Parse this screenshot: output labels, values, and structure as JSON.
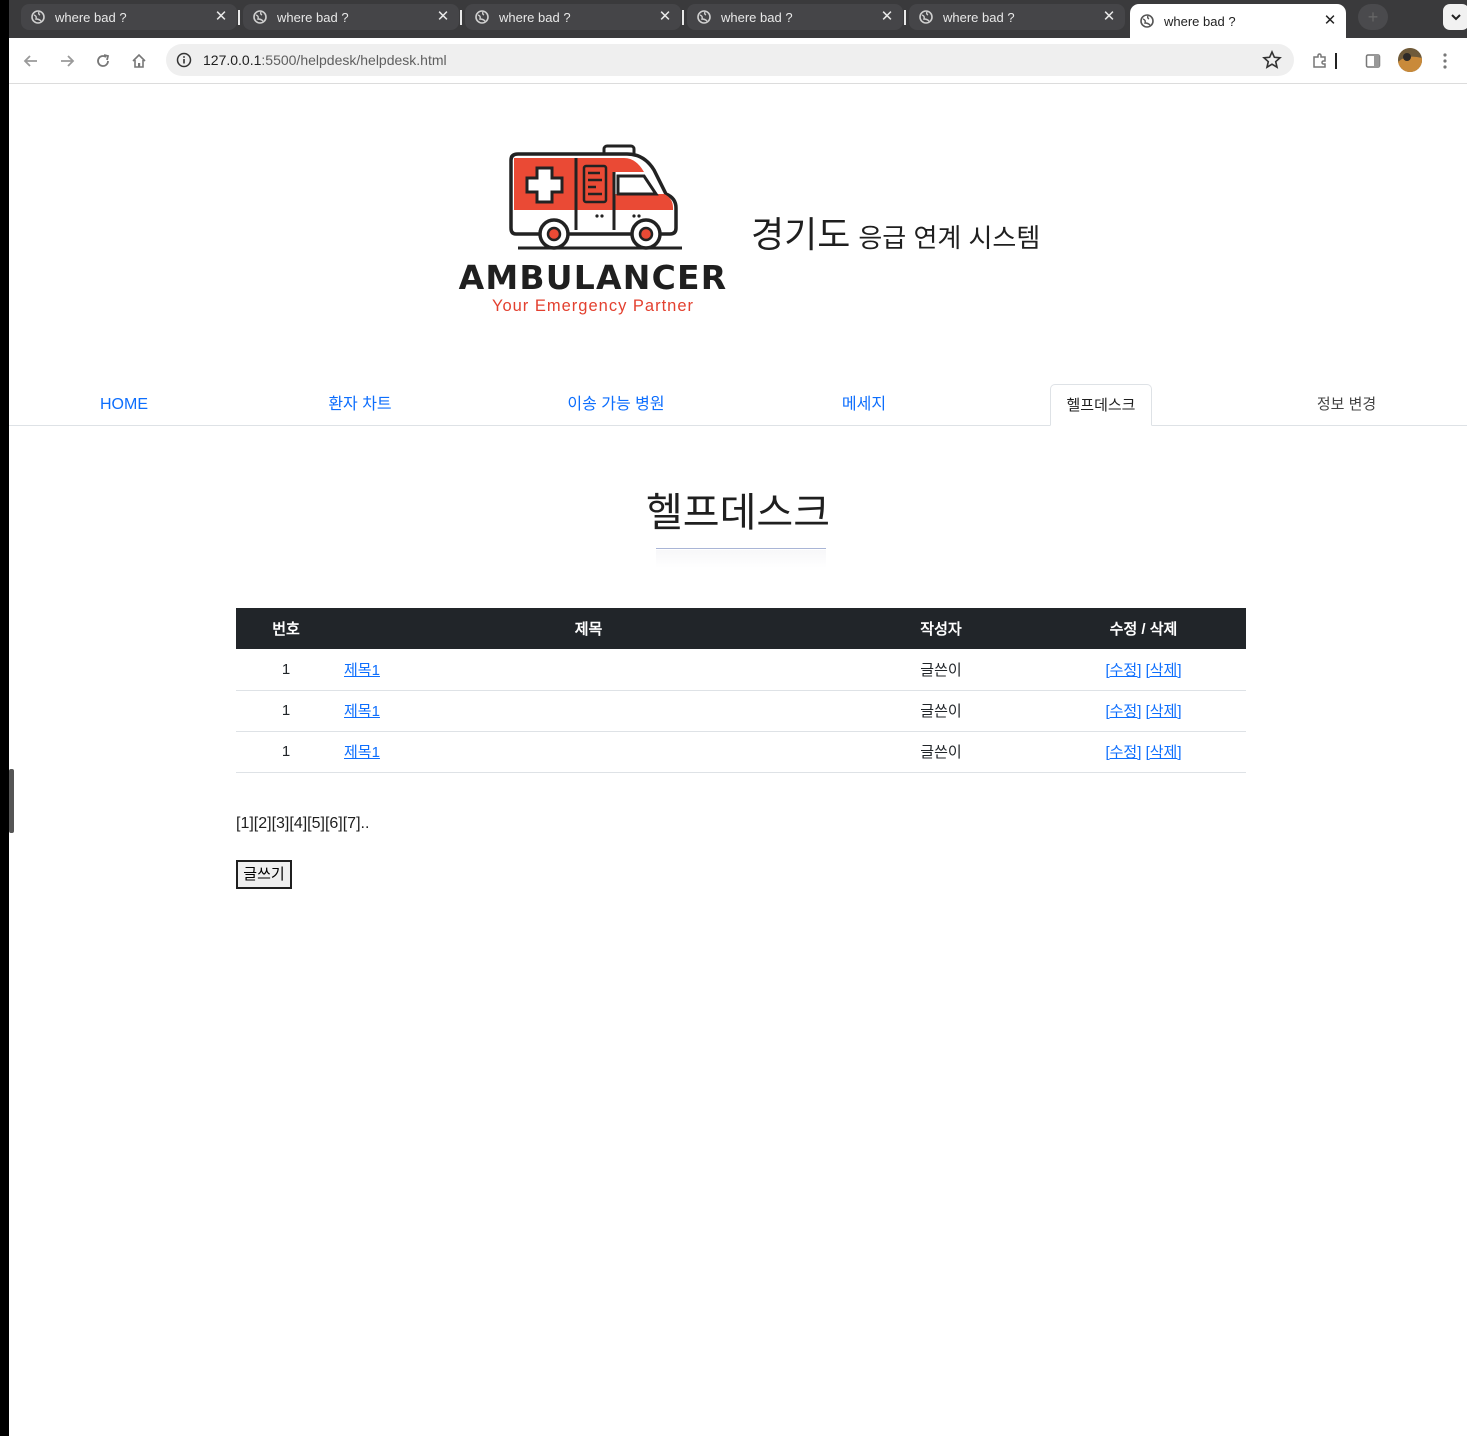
{
  "browser": {
    "tabs": [
      {
        "title": "where bad ?",
        "active": false
      },
      {
        "title": "where bad ?",
        "active": false
      },
      {
        "title": "where bad ?",
        "active": false
      },
      {
        "title": "where bad ?",
        "active": false
      },
      {
        "title": "where bad ?",
        "active": false
      },
      {
        "title": "where bad ?",
        "active": true
      }
    ],
    "url_host": "127.0.0.1",
    "url_rest": ":5500/helpdesk/helpdesk.html"
  },
  "header": {
    "brand_name": "AMBULANCER",
    "brand_tagline": "Your Emergency Partner",
    "system_title_big": "경기도",
    "system_title_small": "응급 연계 시스템"
  },
  "nav": {
    "items": [
      {
        "label": "HOME"
      },
      {
        "label": "환자 차트"
      },
      {
        "label": "이송 가능 병원"
      },
      {
        "label": "메세지"
      },
      {
        "label": "헬프데스크",
        "active": true
      },
      {
        "label": "정보 변경"
      }
    ]
  },
  "main": {
    "heading": "헬프데스크",
    "table": {
      "headers": [
        "번호",
        "제목",
        "작성자",
        "수정 / 삭제"
      ],
      "rows": [
        {
          "num": "1",
          "title": "제목1",
          "writer": "글쓴이",
          "edit": "[수정]",
          "delete": "[삭제]"
        },
        {
          "num": "1",
          "title": "제목1",
          "writer": "글쓴이",
          "edit": "[수정]",
          "delete": "[삭제]"
        },
        {
          "num": "1",
          "title": "제목1",
          "writer": "글쓴이",
          "edit": "[수정]",
          "delete": "[삭제]"
        }
      ]
    },
    "pagination": "[1][2][3][4][5][6][7]..",
    "write_button": "글쓰기"
  },
  "colors": {
    "link": "#0d6efd",
    "table_header_bg": "#212529",
    "brand_red": "#e3402f",
    "tabstrip_bg": "#3a3a3c"
  }
}
